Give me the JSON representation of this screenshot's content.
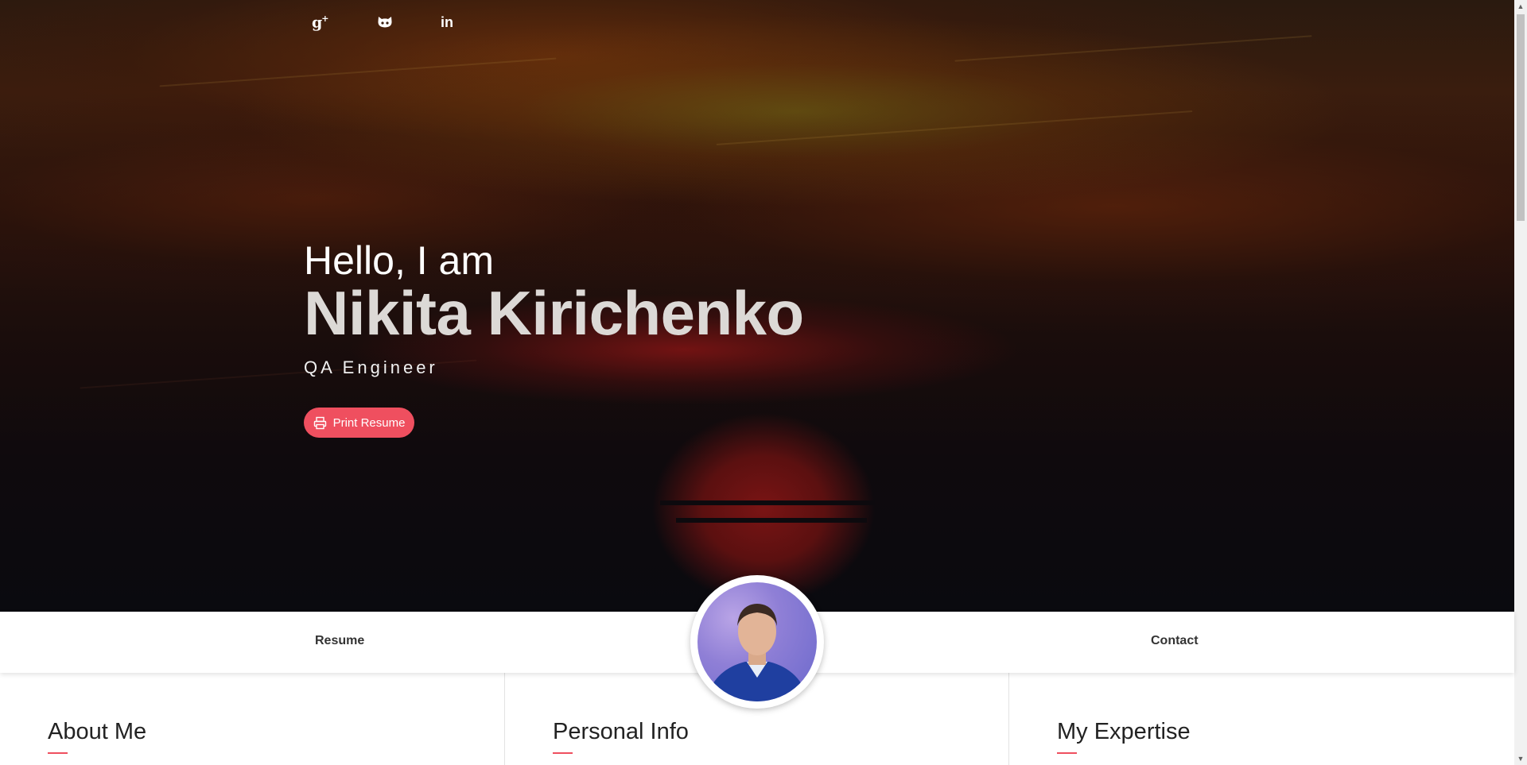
{
  "social": {
    "googleplus_glyph": "g",
    "googleplus_plus": "+",
    "linkedin_glyph": "in",
    "icons": [
      "googleplus-icon",
      "github-icon",
      "linkedin-icon"
    ]
  },
  "hero": {
    "greeting": "Hello, I am",
    "name": "Nikita Kirichenko",
    "role": "QA Engineer",
    "print_button": "Print Resume"
  },
  "nav": {
    "resume": "Resume",
    "contact": "Contact"
  },
  "sections": {
    "about": "About Me",
    "personal": "Personal Info",
    "expertise": "My Expertise"
  },
  "colors": {
    "accent": "#ef4f5f",
    "hero_dark": "#0a0a0f",
    "nav_text": "#333333"
  }
}
